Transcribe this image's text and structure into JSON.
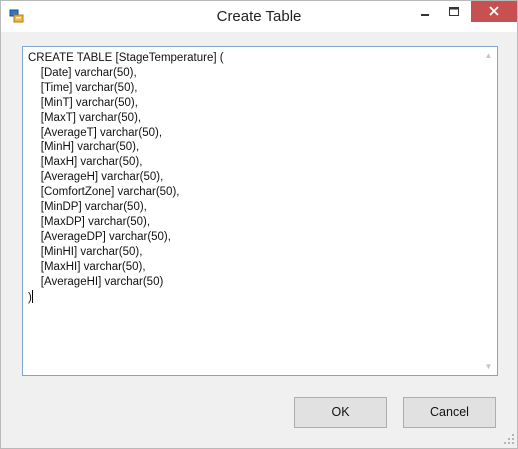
{
  "window": {
    "title": "Create Table",
    "controls": {
      "minimize_icon": "minimize-icon",
      "maximize_icon": "maximize-icon",
      "close_icon": "close-icon",
      "close_color": "#c75050"
    }
  },
  "editor": {
    "lines": [
      "CREATE TABLE [StageTemperature] (",
      "    [Date] varchar(50),",
      "    [Time] varchar(50),",
      "    [MinT] varchar(50),",
      "    [MaxT] varchar(50),",
      "    [AverageT] varchar(50),",
      "    [MinH] varchar(50),",
      "    [MaxH] varchar(50),",
      "    [AverageH] varchar(50),",
      "    [ComfortZone] varchar(50),",
      "    [MinDP] varchar(50),",
      "    [MaxDP] varchar(50),",
      "    [AverageDP] varchar(50),",
      "    [MinHI] varchar(50),",
      "    [MaxHI] varchar(50),",
      "    [AverageHI] varchar(50)",
      ")"
    ],
    "border_color": "#7ea6cf"
  },
  "buttons": {
    "ok_label": "OK",
    "cancel_label": "Cancel"
  }
}
